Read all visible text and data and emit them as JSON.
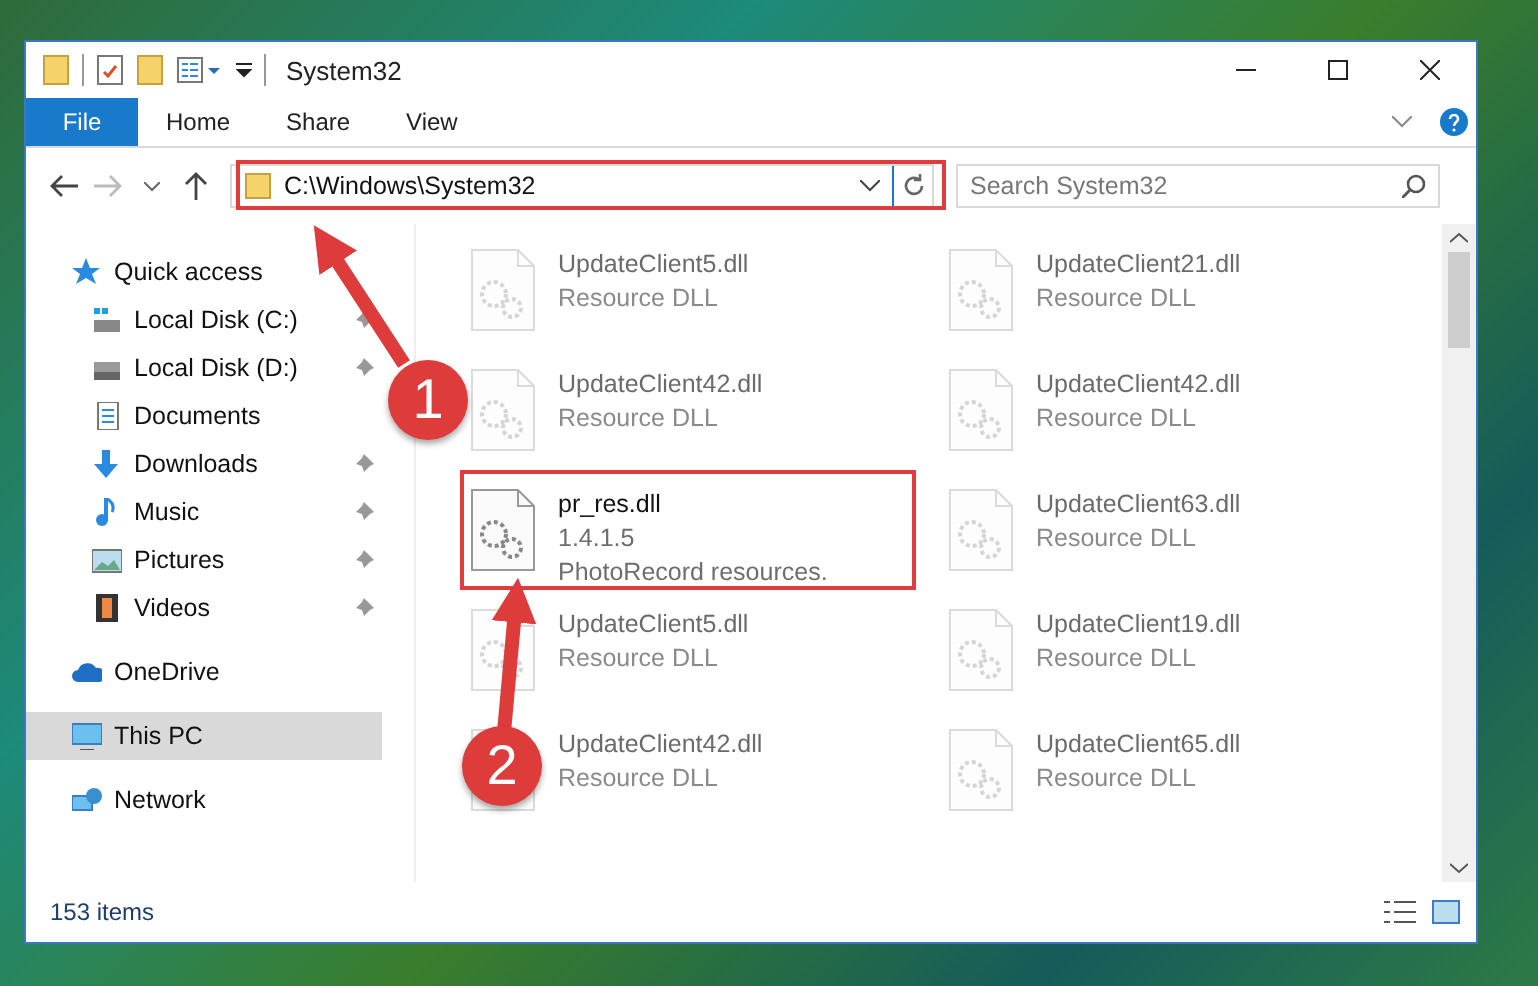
{
  "window": {
    "title": "System32"
  },
  "ribbon_tabs": [
    {
      "label": "File",
      "kind": "file"
    },
    {
      "label": "Home",
      "kind": "tab"
    },
    {
      "label": "Share",
      "kind": "tab"
    },
    {
      "label": "View",
      "kind": "tab"
    }
  ],
  "address": {
    "path": "C:\\Windows\\System32"
  },
  "search": {
    "placeholder": "Search System32"
  },
  "sidebar": {
    "items": [
      {
        "label": "Quick access",
        "selected": false,
        "children": [
          {
            "label": "Local Disk (C:)",
            "pinned": true,
            "selected": false
          },
          {
            "label": "Local Disk (D:)",
            "pinned": true,
            "selected": false
          },
          {
            "label": "Documents",
            "pinned": false,
            "selected": false
          },
          {
            "label": "Downloads",
            "pinned": true,
            "selected": false
          },
          {
            "label": "Music",
            "pinned": true,
            "selected": false
          },
          {
            "label": "Pictures",
            "pinned": true,
            "selected": false
          },
          {
            "label": "Videos",
            "pinned": true,
            "selected": false
          }
        ]
      },
      {
        "label": "OneDrive",
        "selected": false
      },
      {
        "label": "This PC",
        "selected": true
      },
      {
        "label": "Network",
        "selected": false
      }
    ]
  },
  "files": [
    {
      "name": "UpdateClient5.dll",
      "lines": [
        "Resource DLL"
      ],
      "blurred": true
    },
    {
      "name": "UpdateClient21.dll",
      "lines": [
        "Resource DLL"
      ],
      "blurred": true
    },
    {
      "name": "UpdateClient42.dll",
      "lines": [
        "Resource DLL"
      ],
      "blurred": true
    },
    {
      "name": "UpdateClient42.dll",
      "lines": [
        "Resource DLL"
      ],
      "blurred": true
    },
    {
      "name": "pr_res.dll",
      "lines": [
        "1.4.1.5",
        "PhotoRecord resources."
      ],
      "blurred": false
    },
    {
      "name": "UpdateClient63.dll",
      "lines": [
        "Resource DLL"
      ],
      "blurred": true
    },
    {
      "name": "UpdateClient5.dll",
      "lines": [
        "Resource DLL"
      ],
      "blurred": true
    },
    {
      "name": "UpdateClient19.dll",
      "lines": [
        "Resource DLL"
      ],
      "blurred": true
    },
    {
      "name": "UpdateClient42.dll",
      "lines": [
        "Resource DLL"
      ],
      "blurred": true
    },
    {
      "name": "UpdateClient65.dll",
      "lines": [
        "Resource DLL"
      ],
      "blurred": true
    }
  ],
  "status_bar": {
    "count": "153 items"
  },
  "annotations": [
    {
      "kind": "marker",
      "label": "1"
    },
    {
      "kind": "marker",
      "label": "2"
    }
  ]
}
